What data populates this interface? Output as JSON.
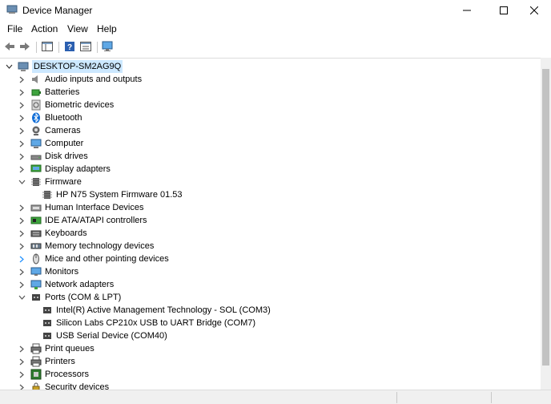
{
  "window": {
    "title": "Device Manager"
  },
  "menu": [
    "File",
    "Action",
    "View",
    "Help"
  ],
  "tree": {
    "root": "DESKTOP-SM2AG9Q",
    "rows": [
      {
        "label": "Audio inputs and outputs",
        "icon": "speaker-icon",
        "expanded": false,
        "child": false
      },
      {
        "label": "Batteries",
        "icon": "battery-icon",
        "expanded": false,
        "child": false
      },
      {
        "label": "Biometric devices",
        "icon": "fingerprint-icon",
        "expanded": false,
        "child": false
      },
      {
        "label": "Bluetooth",
        "icon": "bluetooth-icon",
        "expanded": false,
        "child": false
      },
      {
        "label": "Cameras",
        "icon": "camera-icon",
        "expanded": false,
        "child": false
      },
      {
        "label": "Computer",
        "icon": "computer-icon",
        "expanded": false,
        "child": false
      },
      {
        "label": "Disk drives",
        "icon": "disk-icon",
        "expanded": false,
        "child": false
      },
      {
        "label": "Display adapters",
        "icon": "display-adapter-icon",
        "expanded": false,
        "child": false
      },
      {
        "label": "Firmware",
        "icon": "chip-icon",
        "expanded": true,
        "child": false
      },
      {
        "label": "HP N75 System Firmware 01.53",
        "icon": "chip-icon",
        "child": true
      },
      {
        "label": "Human Interface Devices",
        "icon": "hid-icon",
        "expanded": false,
        "child": false
      },
      {
        "label": "IDE ATA/ATAPI controllers",
        "icon": "controller-icon",
        "expanded": false,
        "child": false
      },
      {
        "label": "Keyboards",
        "icon": "keyboard-icon",
        "expanded": false,
        "child": false
      },
      {
        "label": "Memory technology devices",
        "icon": "memory-icon",
        "expanded": false,
        "child": false
      },
      {
        "label": "Mice and other pointing devices",
        "icon": "mouse-icon",
        "expanded": false,
        "child": false,
        "hover": true
      },
      {
        "label": "Monitors",
        "icon": "monitor-icon",
        "expanded": false,
        "child": false
      },
      {
        "label": "Network adapters",
        "icon": "network-icon",
        "expanded": false,
        "child": false
      },
      {
        "label": "Ports (COM & LPT)",
        "icon": "port-icon",
        "expanded": true,
        "child": false
      },
      {
        "label": "Intel(R) Active Management Technology - SOL (COM3)",
        "icon": "port-icon",
        "child": true
      },
      {
        "label": "Silicon Labs CP210x USB to UART Bridge (COM7)",
        "icon": "port-icon",
        "child": true
      },
      {
        "label": "USB Serial Device (COM40)",
        "icon": "port-icon",
        "child": true
      },
      {
        "label": "Print queues",
        "icon": "printer-icon",
        "expanded": false,
        "child": false
      },
      {
        "label": "Printers",
        "icon": "printer-icon",
        "expanded": false,
        "child": false
      },
      {
        "label": "Processors",
        "icon": "processor-icon",
        "expanded": false,
        "child": false
      },
      {
        "label": "Security devices",
        "icon": "security-icon",
        "expanded": false,
        "child": false
      }
    ]
  },
  "colors": {
    "selection": "#cce8ff",
    "accent": "#0078d7"
  }
}
